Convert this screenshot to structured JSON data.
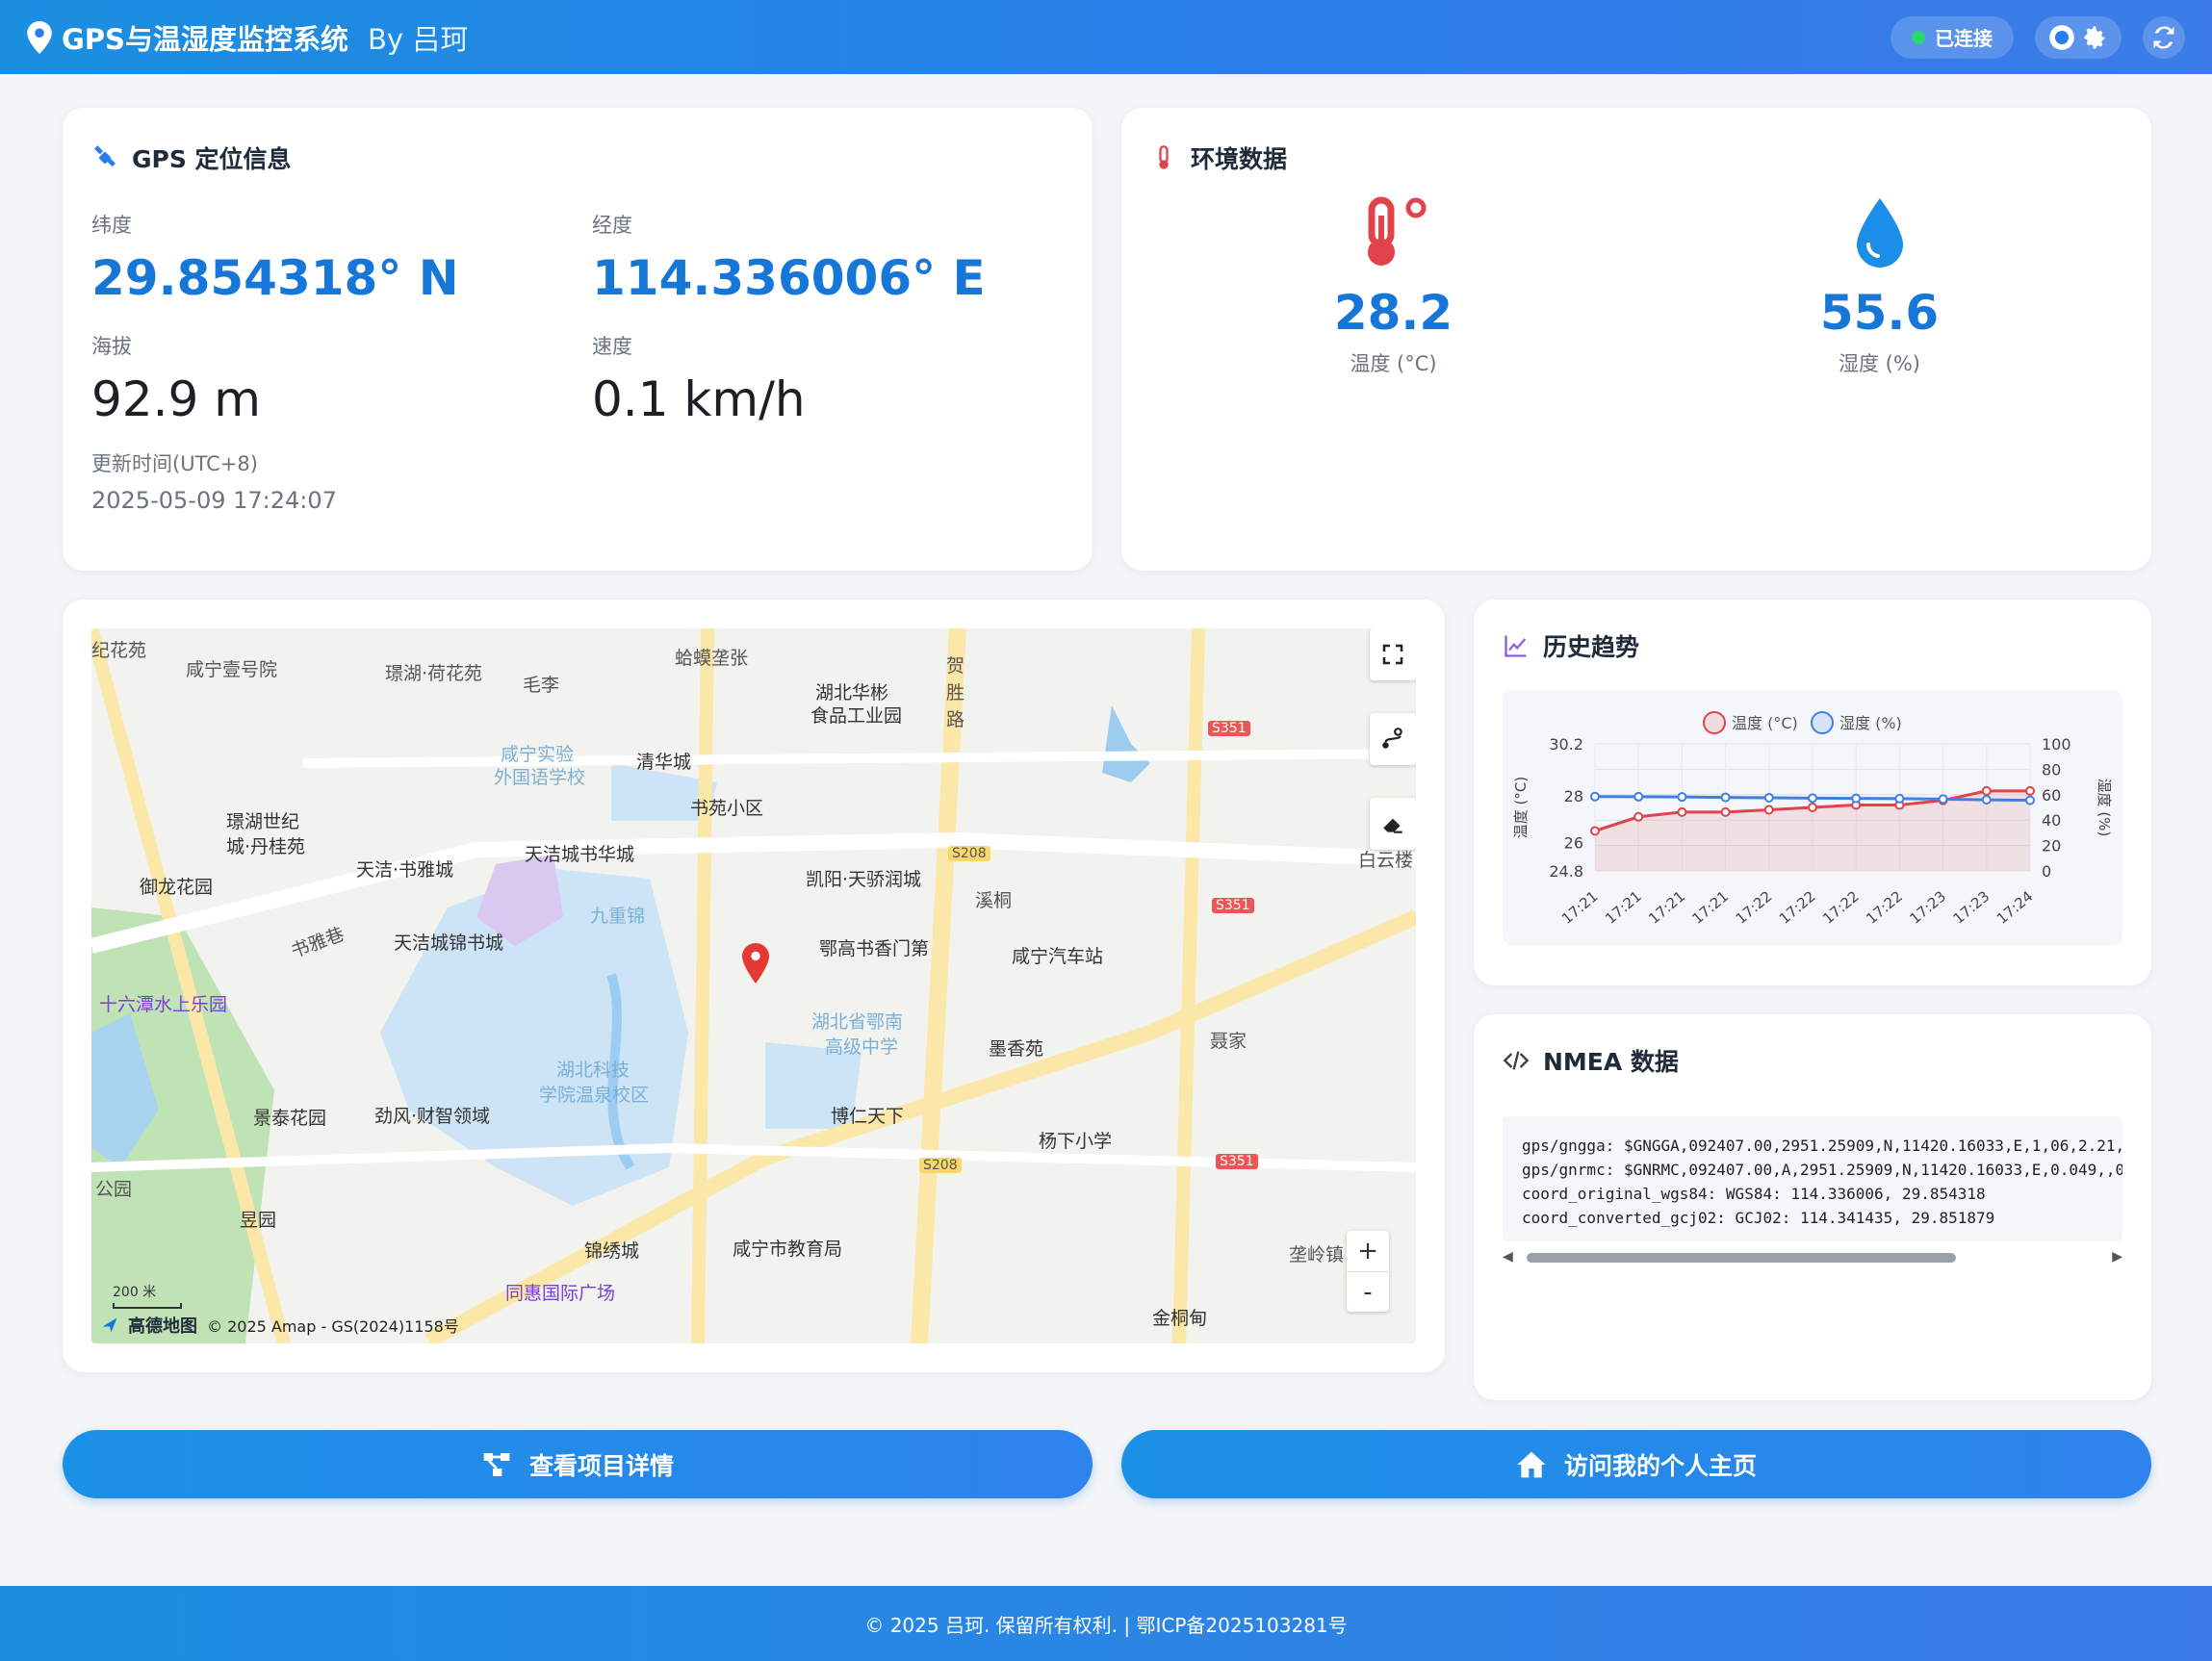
{
  "header": {
    "title": "GPS与温湿度监控系统",
    "by": "By 吕珂",
    "status": "已连接"
  },
  "gps": {
    "title": "GPS 定位信息",
    "lat_label": "纬度",
    "lat_value": "29.854318° N",
    "lon_label": "经度",
    "lon_value": "114.336006° E",
    "alt_label": "海拔",
    "alt_value": "92.9 m",
    "speed_label": "速度",
    "speed_value": "0.1 km/h",
    "updated_label": "更新时间(UTC+8)",
    "updated_value": "2025-05-09 17:24:07"
  },
  "env": {
    "title": "环境数据",
    "temp_value": "28.2",
    "temp_label": "温度 (°C)",
    "hum_value": "55.6",
    "hum_label": "湿度 (%)"
  },
  "map": {
    "labels": [
      "纪花苑",
      "咸宁壹号院",
      "璟湖·荷花苑",
      "毛李",
      "蛤蟆垄张",
      "湖北华彬",
      "食品工业园",
      "贺",
      "胜",
      "路",
      "咸宁实验",
      "外国语学校",
      "清华城",
      "书苑小区",
      "璟湖世纪",
      "城·丹桂苑",
      "天洁·书雅城",
      "天洁城书华城",
      "御龙花园",
      "书雅巷",
      "天洁城锦书城",
      "九重锦",
      "凯阳·天骄润城",
      "鄂高书香门第",
      "咸宁汽车站",
      "溪桐",
      "白云楼",
      "十六潭水上乐园",
      "湖北省鄂南",
      "高级中学",
      "墨香苑",
      "聂家",
      "湖北科技",
      "学院温泉校区",
      "景泰花园",
      "劲风·财智领域",
      "博仁天下",
      "杨下小学",
      "公园",
      "昱园",
      "锦绣城",
      "咸宁市教育局",
      "同惠国际广场",
      "垄岭镇",
      "金桐甸",
      "S208",
      "S208",
      "S208",
      "S351",
      "S351",
      "S351"
    ],
    "scale": "200 米",
    "logo": "高德地图",
    "copyright": "© 2025 Amap - GS(2024)1158号",
    "zoom_in": "+",
    "zoom_out": "-"
  },
  "history": {
    "title": "历史趋势"
  },
  "chart_data": {
    "type": "line",
    "x": [
      "17:21",
      "17:21",
      "17:21",
      "17:21",
      "17:22",
      "17:22",
      "17:22",
      "17:22",
      "17:23",
      "17:23",
      "17:24"
    ],
    "series": [
      {
        "name": "温度 (°C)",
        "color": "#e0434b",
        "axis": "left",
        "values": [
          26.5,
          27.1,
          27.3,
          27.3,
          27.4,
          27.5,
          27.6,
          27.6,
          27.8,
          28.2,
          28.2
        ]
      },
      {
        "name": "湿度 (%)",
        "color": "#3f7fe6",
        "axis": "right",
        "values": [
          58.5,
          58.4,
          58.2,
          57.9,
          57.6,
          57.3,
          57.1,
          56.9,
          56.5,
          56.0,
          55.6
        ]
      }
    ],
    "ylabel": "温度 (°C)",
    "ylabel_right": "湿度 (%)",
    "ylim": [
      24.8,
      30.2
    ],
    "ylim_right": [
      0,
      100
    ],
    "yticks": [
      "30.2",
      "28",
      "26",
      "24.8"
    ],
    "yticks_right": [
      "100",
      "80",
      "60",
      "40",
      "20",
      "0"
    ],
    "legend": "top",
    "grid": true
  },
  "nmea": {
    "title": "NMEA 数据",
    "lines": [
      "gps/gngga: $GNGGA,092407.00,2951.25909,N,11420.16033,E,1,06,2.21,",
      "gps/gnrmc: $GNRMC,092407.00,A,2951.25909,N,11420.16033,E,0.049,,0",
      "coord_original_wgs84: WGS84: 114.336006, 29.854318",
      "coord_converted_gcj02: GCJ02: 114.341435, 29.851879"
    ]
  },
  "buttons": {
    "detail": "查看项目详情",
    "home": "访问我的个人主页"
  },
  "footer": {
    "text": "© 2025 吕珂. 保留所有权利. | 鄂ICP备2025103281号"
  }
}
